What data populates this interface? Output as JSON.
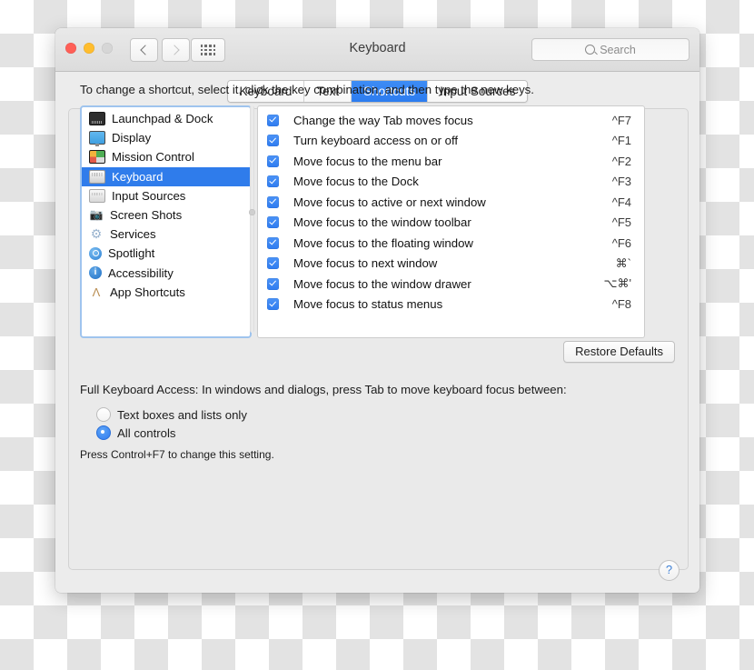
{
  "window": {
    "title": "Keyboard",
    "traffic_lights": [
      "close",
      "minimize",
      "zoom"
    ],
    "nav": {
      "back": "‹",
      "forward": "›",
      "grid": "grid-view"
    },
    "search": {
      "placeholder": "Search",
      "value": ""
    }
  },
  "tabs": [
    {
      "label": "Keyboard",
      "active": false
    },
    {
      "label": "Text",
      "active": false
    },
    {
      "label": "Shortcuts",
      "active": true
    },
    {
      "label": "Input Sources",
      "active": false
    }
  ],
  "hint": "To change a shortcut, select it, click the key combination, and then type the new keys.",
  "sidebar": {
    "items": [
      {
        "label": "Launchpad & Dock",
        "icon": "launchpad-dock-icon",
        "selected": false
      },
      {
        "label": "Display",
        "icon": "display-icon",
        "selected": false
      },
      {
        "label": "Mission Control",
        "icon": "mission-control-icon",
        "selected": false
      },
      {
        "label": "Keyboard",
        "icon": "keyboard-icon",
        "selected": true
      },
      {
        "label": "Input Sources",
        "icon": "input-sources-icon",
        "selected": false
      },
      {
        "label": "Screen Shots",
        "icon": "screenshot-icon",
        "glyph": "📷",
        "selected": false
      },
      {
        "label": "Services",
        "icon": "gear-icon",
        "glyph": "⚙",
        "selected": false
      },
      {
        "label": "Spotlight",
        "icon": "spotlight-icon",
        "selected": false
      },
      {
        "label": "Accessibility",
        "icon": "accessibility-icon",
        "glyph": "ⓘ",
        "selected": false
      },
      {
        "label": "App Shortcuts",
        "icon": "app-shortcuts-icon",
        "glyph": "Λ",
        "selected": false
      }
    ]
  },
  "shortcuts": [
    {
      "checked": true,
      "name": "Change the way Tab moves focus",
      "key": "^F7"
    },
    {
      "checked": true,
      "name": "Turn keyboard access on or off",
      "key": "^F1"
    },
    {
      "checked": true,
      "name": "Move focus to the menu bar",
      "key": "^F2"
    },
    {
      "checked": true,
      "name": "Move focus to the Dock",
      "key": "^F3"
    },
    {
      "checked": true,
      "name": "Move focus to active or next window",
      "key": "^F4"
    },
    {
      "checked": true,
      "name": "Move focus to the window toolbar",
      "key": "^F5"
    },
    {
      "checked": true,
      "name": "Move focus to the floating window",
      "key": "^F6"
    },
    {
      "checked": true,
      "name": "Move focus to next window",
      "key": "⌘`"
    },
    {
      "checked": true,
      "name": "Move focus to the window drawer",
      "key": "⌥⌘'"
    },
    {
      "checked": true,
      "name": "Move focus to status menus",
      "key": "^F8"
    }
  ],
  "restore_defaults_label": "Restore Defaults",
  "full_keyboard_access": {
    "description": "Full Keyboard Access: In windows and dialogs, press Tab to move keyboard focus between:",
    "options": [
      {
        "label": "Text boxes and lists only",
        "selected": false
      },
      {
        "label": "All controls",
        "selected": true
      }
    ],
    "note": "Press Control+F7 to change this setting."
  },
  "help_label": "?",
  "colors": {
    "accent": "#2f7cf0",
    "selection": "#2f7ceb",
    "window_bg": "#ececec",
    "panel_bg": "#eaeaea"
  }
}
